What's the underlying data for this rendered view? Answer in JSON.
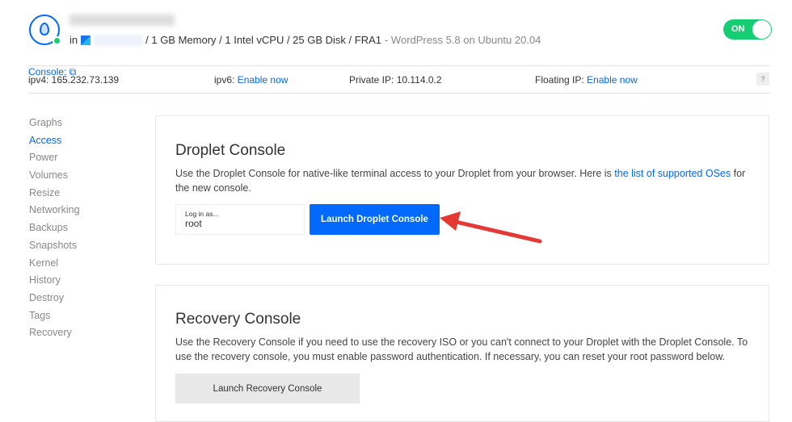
{
  "header": {
    "meta_in": "in",
    "specs": "/ 1 GB Memory / 1 Intel vCPU / 25 GB Disk / FRA1",
    "image": "- WordPress 5.8 on Ubuntu 20.04",
    "power": "ON"
  },
  "infobar": {
    "ipv4": "ipv4: 165.232.73.139",
    "ipv6_label": "ipv6:",
    "ipv6_link": "Enable now",
    "private_label": "Private IP:",
    "private_value": "10.114.0.2",
    "floating_label": "Floating IP:",
    "floating_link": "Enable now",
    "console": "Console:",
    "help": "?"
  },
  "sidebar": {
    "items": [
      "Graphs",
      "Access",
      "Power",
      "Volumes",
      "Resize",
      "Networking",
      "Backups",
      "Snapshots",
      "Kernel",
      "History",
      "Destroy",
      "Tags",
      "Recovery"
    ],
    "active": "Access"
  },
  "droplet_console": {
    "title": "Droplet Console",
    "text1": "Use the Droplet Console for native-like terminal access to your Droplet from your browser. Here is",
    "link": "the list of supported OSes",
    "text2": "for the new console.",
    "login_label": "Log in as...",
    "login_value": "root",
    "button": "Launch Droplet Console"
  },
  "recovery_console": {
    "title": "Recovery Console",
    "text": "Use the Recovery Console if you need to use the recovery ISO or you can't connect to your Droplet with the Droplet Console. To use the recovery console, you must enable password authentication. If necessary, you can reset your root password below.",
    "button": "Launch Recovery Console"
  }
}
